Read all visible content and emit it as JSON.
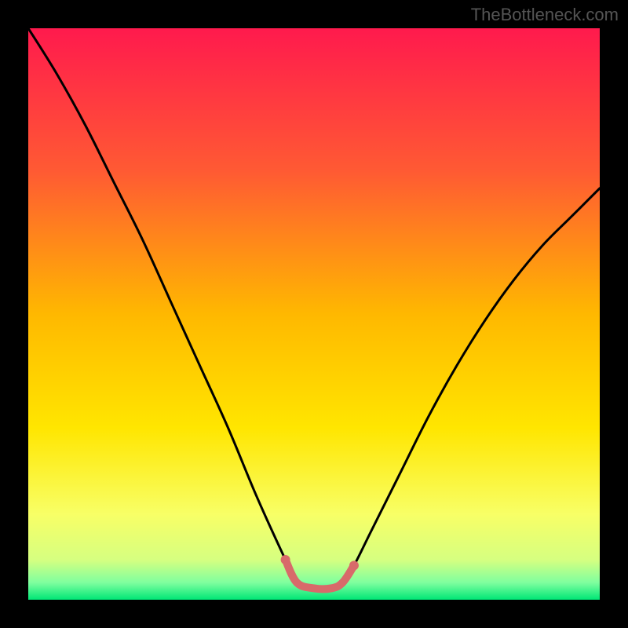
{
  "watermark": "TheBottleneck.com",
  "chart_data": {
    "type": "line",
    "title": "",
    "xlabel": "",
    "ylabel": "",
    "xlim": [
      0,
      100
    ],
    "ylim": [
      0,
      100
    ],
    "background": {
      "type": "vertical_gradient",
      "stops": [
        {
          "pos": 0.0,
          "color": "#ff1a4d"
        },
        {
          "pos": 0.25,
          "color": "#ff5a33"
        },
        {
          "pos": 0.5,
          "color": "#ffb800"
        },
        {
          "pos": 0.7,
          "color": "#ffe600"
        },
        {
          "pos": 0.85,
          "color": "#f8ff66"
        },
        {
          "pos": 0.93,
          "color": "#d6ff80"
        },
        {
          "pos": 0.97,
          "color": "#7fff9f"
        },
        {
          "pos": 1.0,
          "color": "#00e676"
        }
      ]
    },
    "series": [
      {
        "name": "bottleneck-curve",
        "color": "#000000",
        "x": [
          0,
          5,
          10,
          15,
          20,
          25,
          30,
          35,
          40,
          45,
          47,
          50,
          53,
          55,
          57,
          60,
          65,
          70,
          75,
          80,
          85,
          90,
          95,
          100
        ],
        "y": [
          100,
          92,
          83,
          73,
          63,
          52,
          41,
          30,
          18,
          7,
          3,
          2,
          2,
          3,
          6,
          12,
          22,
          32,
          41,
          49,
          56,
          62,
          67,
          72
        ]
      }
    ],
    "highlight": {
      "name": "bottom-highlight",
      "color": "#d86a6a",
      "x": [
        45,
        47,
        50,
        53,
        55,
        57
      ],
      "y": [
        7,
        3,
        2,
        2,
        3,
        6
      ]
    }
  }
}
